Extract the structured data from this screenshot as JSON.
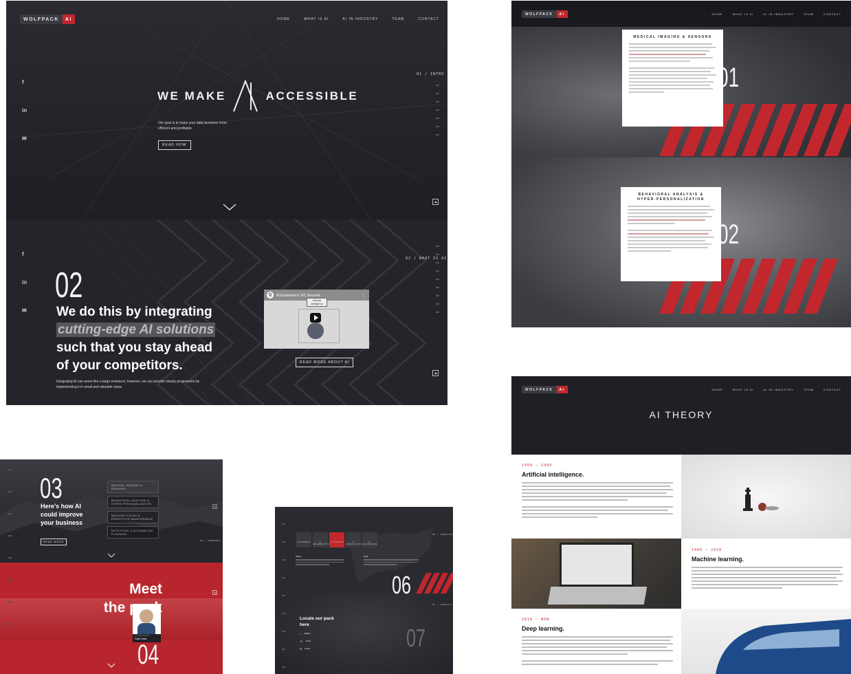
{
  "brand": {
    "name": "WOLFPACK",
    "suffix": "AI",
    "accent": "#c1272d",
    "dark": "#1f2025"
  },
  "nav": [
    "HOME",
    "WHAT IS AI",
    "AI IN INDUSTRY",
    "TEAM",
    "CONTACT"
  ],
  "nav_b": [
    "HOME",
    "WHAT IS AI",
    "AI IN INDUSTRY",
    "TEAM",
    "CONTACT"
  ],
  "social": {
    "facebook": "f",
    "linkedin": "in",
    "mail": "✉"
  },
  "hero": {
    "title_left": "WE MAKE",
    "title_right": "ACCESSIBLE",
    "subtitle": "Our goal is to make your daily business more efficient and profitable.",
    "button": "READ HOW",
    "section_label": "01 / INTRO"
  },
  "section2": {
    "number": "02",
    "label": "02 / WHAT IS AI",
    "heading_1": "We do this by integrating",
    "heading_highlight": "cutting-edge AI solutions",
    "heading_2": "such that you stay ahead of your competitors.",
    "body": "Integrating AI can seem like a large endeavor, however, we can provide steady progression by implementing it in small and valuable steps.",
    "video_title": "AI Explained in 101 Seconds",
    "video_channel": "Q",
    "video_label_1": "Artificial",
    "video_label_2": "Intelligence",
    "button": "READ MORE ABOUT AI"
  },
  "industry": {
    "card1_title": "MEDICAL IMAGING & SENSORS",
    "card1_number": "01",
    "card2_title_1": "BEHAVIORAL ANALYSIS &",
    "card2_title_2": "HYPER-PERSONALIZATION",
    "card2_number": "02"
  },
  "theory": {
    "title": "AI THEORY",
    "items": [
      {
        "years": "1950 – 1980",
        "title": "Artificial intelligence."
      },
      {
        "years": "1980 – 2010",
        "title": "Machine learning."
      },
      {
        "years": "2010 – NOW",
        "title": "Deep learning."
      }
    ]
  },
  "section3": {
    "number": "03",
    "heading": "Here's how AI could improve your business",
    "button": "READ MORE",
    "menu": [
      "MEDICAL IMAGING & SENSORS",
      "BEHAVIORAL ANALYSIS & HYPER-PERSONALIZATION",
      "MACHINE VISION & PREDICTIVE MAINTENANCE",
      "DETECTION & AUTOMATION PLANNING"
    ],
    "label": "03 / INDUSTRY"
  },
  "section4": {
    "number": "04",
    "heading_1": "Meet",
    "heading_2": "the pack",
    "person_role": "AI SPECIALIST",
    "person_name": "Gabe Jetta"
  },
  "section6": {
    "number": "06",
    "tabs": [
      "AI STRATEGY",
      "AI IMPLEMENTATION",
      "AI TRAINING",
      "AI CONSULTATION",
      "AI MAINTENANCE"
    ],
    "col1_title": "Vision",
    "col2_title": "Goal",
    "label": "06 / SERVICES"
  },
  "section7": {
    "number": "07",
    "heading": "Locate our pack here",
    "label": "07 / CONTACT",
    "addr_title": "Address",
    "phone_title": "Phone",
    "mail_title": "E-mail"
  }
}
